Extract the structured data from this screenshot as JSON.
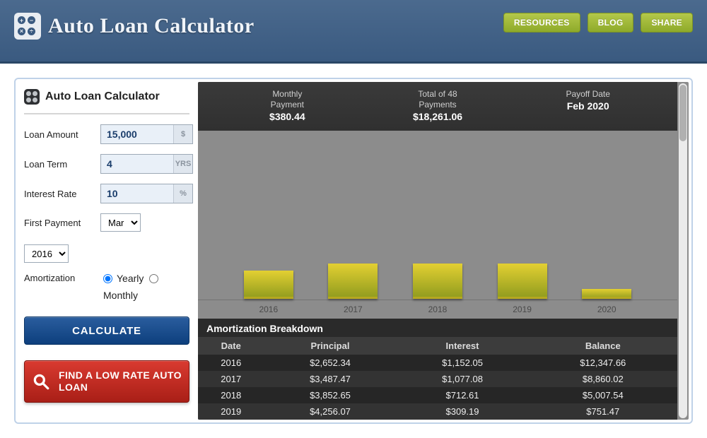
{
  "header": {
    "title": "Auto Loan Calculator",
    "buttons": {
      "resources": "RESOURCES",
      "blog": "BLOG",
      "share": "SHARE"
    }
  },
  "panel": {
    "title": "Auto Loan Calculator"
  },
  "form": {
    "loan_amount": {
      "label": "Loan Amount",
      "value": "15,000",
      "unit": "$"
    },
    "loan_term": {
      "label": "Loan Term",
      "value": "4",
      "unit": "YRS"
    },
    "interest_rate": {
      "label": "Interest Rate",
      "value": "10",
      "unit": "%"
    },
    "first_payment": {
      "label": "First Payment",
      "month": "Mar",
      "year": "2016"
    },
    "amortization": {
      "label": "Amortization",
      "yearly_label": "Yearly",
      "monthly_label": "Monthly",
      "selected": "yearly"
    },
    "calculate_label": "CALCULATE",
    "find_loan_label": "FIND A LOW RATE AUTO LOAN"
  },
  "summary": {
    "monthly": {
      "label": "Monthly Payment",
      "value": "$380.44"
    },
    "total": {
      "label": "Total of 48 Payments",
      "value": "$18,261.06"
    },
    "payoff": {
      "label": "Payoff Date",
      "value": "Feb 2020"
    }
  },
  "chart_data": {
    "type": "bar",
    "title": "",
    "xlabel": "",
    "ylabel": "",
    "categories": [
      "2016",
      "2017",
      "2018",
      "2019",
      "2020"
    ],
    "values_rel": [
      40,
      50,
      50,
      50,
      14
    ],
    "note": "relative bar heights estimated from pixels; axis has no numeric labels"
  },
  "breakdown": {
    "title": "Amortization Breakdown",
    "columns": [
      "Date",
      "Principal",
      "Interest",
      "Balance"
    ],
    "rows": [
      {
        "date": "2016",
        "principal": "$2,652.34",
        "interest": "$1,152.05",
        "balance": "$12,347.66"
      },
      {
        "date": "2017",
        "principal": "$3,487.47",
        "interest": "$1,077.08",
        "balance": "$8,860.02"
      },
      {
        "date": "2018",
        "principal": "$3,852.65",
        "interest": "$712.61",
        "balance": "$5,007.54"
      },
      {
        "date": "2019",
        "principal": "$4,256.07",
        "interest": "$309.19",
        "balance": "$751.47"
      }
    ]
  }
}
